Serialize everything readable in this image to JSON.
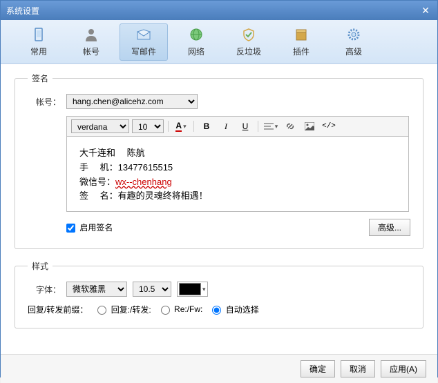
{
  "title": "系统设置",
  "tabs": [
    {
      "label": "常用"
    },
    {
      "label": "帐号"
    },
    {
      "label": "写邮件"
    },
    {
      "label": "网络"
    },
    {
      "label": "反垃圾"
    },
    {
      "label": "插件"
    },
    {
      "label": "高级"
    }
  ],
  "signature": {
    "legend": "签名",
    "account_label": "帐号：",
    "account_value": "hang.chen@alicehz.com",
    "font_name": "verdana",
    "font_size": "10",
    "body": {
      "line1": "大千连和　 陈航",
      "line2_label": "手　 机：",
      "line2_value": "13477615515",
      "line3_label": "微信号：",
      "line3_value": "wx--chenhang",
      "line4": "签　 名：有趣的灵魂终将相遇！"
    },
    "enable_label": "启用签名",
    "advanced_btn": "高级..."
  },
  "style": {
    "legend": "样式",
    "font_label": "字体：",
    "font_name": "微软雅黑",
    "font_size": "10.5",
    "prefix_label": "回复/转发前缀：",
    "opt1": "回复:/转发:",
    "opt2": "Re:/Fw:",
    "opt3": "自动选择"
  },
  "footer": {
    "ok": "确定",
    "cancel": "取消",
    "apply": "应用(A)"
  }
}
